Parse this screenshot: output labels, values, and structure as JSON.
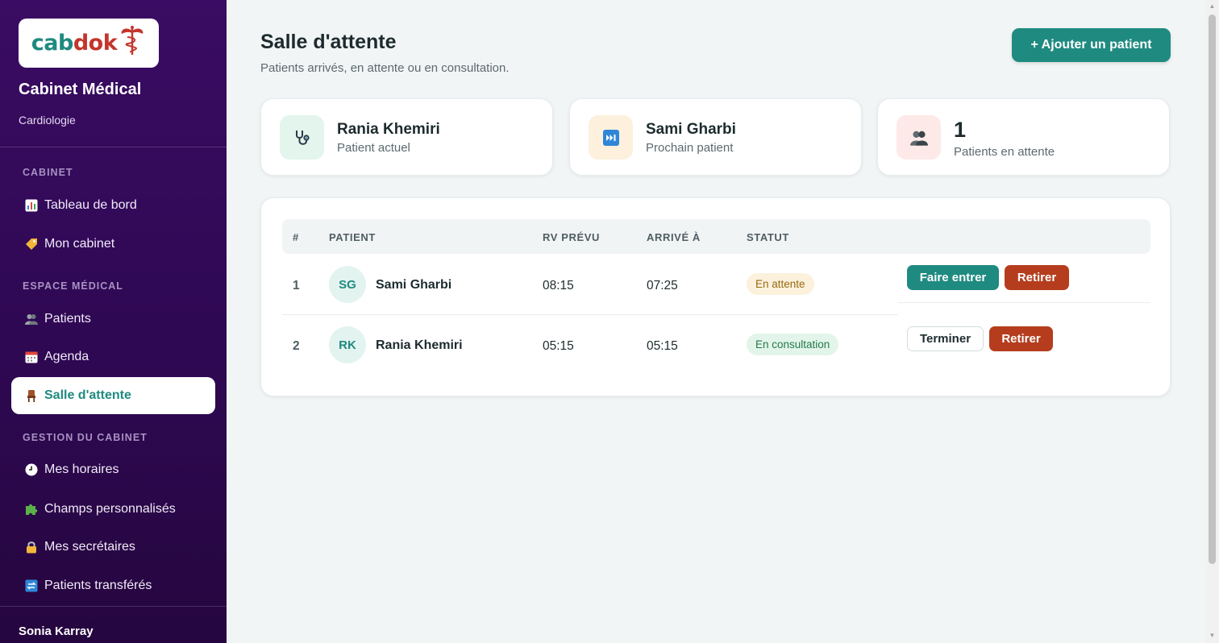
{
  "sidebar": {
    "logo": {
      "part1": "cab",
      "part2": "dok"
    },
    "cabinet_name": "Cabinet Médical",
    "specialty": "Cardiologie",
    "sections": [
      {
        "label": "CABINET",
        "items": [
          {
            "label": "Tableau de bord",
            "icon": "bar-chart-icon"
          },
          {
            "label": "Mon cabinet",
            "icon": "tag-icon"
          }
        ]
      },
      {
        "label": "ESPACE MÉDICAL",
        "items": [
          {
            "label": "Patients",
            "icon": "people-icon"
          },
          {
            "label": "Agenda",
            "icon": "calendar-icon"
          },
          {
            "label": "Salle d'attente",
            "icon": "chair-icon",
            "active": true
          }
        ]
      },
      {
        "label": "GESTION DU CABINET",
        "items": [
          {
            "label": "Mes horaires",
            "icon": "clock-icon"
          },
          {
            "label": "Champs personnalisés",
            "icon": "puzzle-icon"
          },
          {
            "label": "Mes secrétaires",
            "icon": "lock-icon"
          },
          {
            "label": "Patients transférés",
            "icon": "transfer-icon"
          }
        ]
      }
    ],
    "user_name": "Sonia Karray"
  },
  "header": {
    "title": "Salle d'attente",
    "subtitle": "Patients arrivés, en attente ou en consultation.",
    "add_button": "+ Ajouter un patient"
  },
  "stats": [
    {
      "value": "Rania Khemiri",
      "label": "Patient actuel",
      "icon": "stethoscope-icon",
      "bg": "#e3f5ec"
    },
    {
      "value": "Sami Gharbi",
      "label": "Prochain patient",
      "icon": "next-track-icon",
      "bg": "#fdf0dd"
    },
    {
      "value": "1",
      "label": "Patients en attente",
      "icon": "people-icon",
      "bg": "#fde9e7"
    }
  ],
  "table": {
    "headers": [
      "#",
      "PATIENT",
      "RV PRÉVU",
      "ARRIVÉ À",
      "STATUT"
    ],
    "rows": [
      {
        "num": "1",
        "initials": "SG",
        "name": "Sami Gharbi",
        "rv": "08:15",
        "arrive": "07:25",
        "status": "En attente",
        "status_type": "wait",
        "actions": [
          "Faire entrer",
          "Retirer"
        ]
      },
      {
        "num": "2",
        "initials": "RK",
        "name": "Rania Khemiri",
        "rv": "05:15",
        "arrive": "05:15",
        "status": "En consultation",
        "status_type": "consult",
        "actions": [
          "Terminer",
          "Retirer"
        ]
      }
    ]
  },
  "colors": {
    "accent": "#1f8a80",
    "danger": "#b53d1e",
    "sidebar": "#2e0852"
  }
}
